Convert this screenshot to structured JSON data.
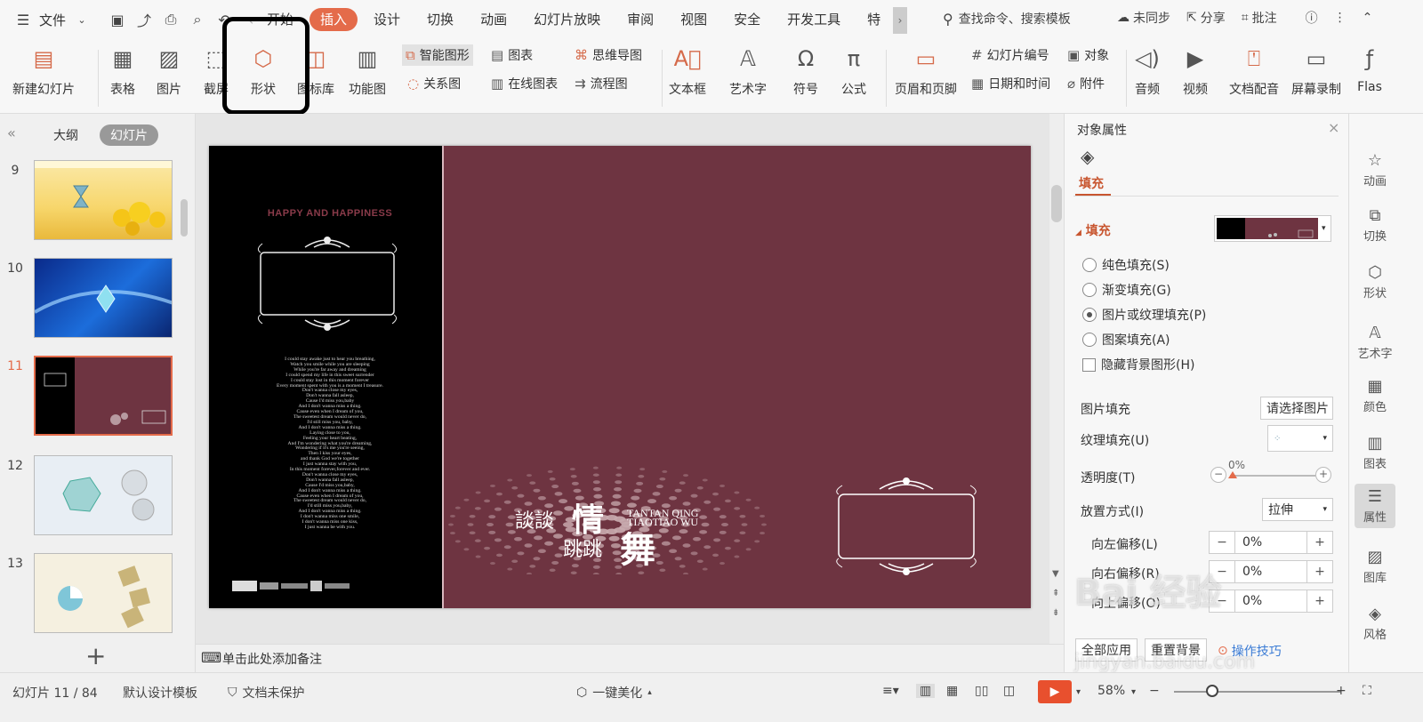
{
  "topbar": {
    "file_label": "文件",
    "tabs": [
      {
        "label": "开始"
      },
      {
        "label": "插入"
      },
      {
        "label": "设计"
      },
      {
        "label": "切换"
      },
      {
        "label": "动画"
      },
      {
        "label": "幻灯片放映"
      },
      {
        "label": "审阅"
      },
      {
        "label": "视图"
      },
      {
        "label": "安全"
      },
      {
        "label": "开发工具"
      },
      {
        "label": "特"
      }
    ],
    "search_label": "查找命令、搜索模板",
    "sync_label": "未同步",
    "share_label": "分享",
    "comment_label": "批注"
  },
  "ribbon": {
    "new_slide": "新建幻灯片",
    "table": "表格",
    "picture": "图片",
    "screenshot": "截屏",
    "shape": "形状",
    "icon_lib": "图标库",
    "function_chart": "功能图",
    "smart_art": "智能图形",
    "chart": "图表",
    "mind_map": "思维导图",
    "relation": "关系图",
    "online_chart": "在线图表",
    "flow_chart": "流程图",
    "text_box": "文本框",
    "art_text": "艺术字",
    "symbol": "符号",
    "formula": "公式",
    "header_footer": "页眉和页脚",
    "slide_number": "幻灯片编号",
    "object": "对象",
    "date_time": "日期和时间",
    "attachment": "附件",
    "audio": "音频",
    "video": "视频",
    "narration": "文档配音",
    "screen_record": "屏幕录制",
    "flash": "Flas"
  },
  "left_panel": {
    "tab_outline": "大纲",
    "tab_slides": "幻灯片",
    "thumbs": [
      {
        "num": "9"
      },
      {
        "num": "10"
      },
      {
        "num": "11"
      },
      {
        "num": "12"
      },
      {
        "num": "13"
      }
    ]
  },
  "slide": {
    "happy_text": "HAPPY AND HAPPINESS",
    "lyrics": [
      "I could stay awake just to hear you breathing,",
      "Watch you smile while you are sleeping",
      "While you're far away and dreaming",
      "I could spend my life in this sweet surrender",
      "I could stay lost in this moment forever",
      "Every moment spent with you is a moment I treasure.",
      "Don't wanna close my eyes,",
      "Don't wanna fall asleep,",
      "Cause I'd miss you,baby",
      "And I don't wanna miss a thing.",
      "Cause even when I dream of you,",
      "The sweetest dream would never do,",
      "I'd still miss you, baby,",
      "And I don't wanna miss a thing.",
      "Laying close to you,",
      "Feeling your heart beating,",
      "And I'm wondering what you're dreaming,",
      "Wondering if it's me you're seeing,",
      "Then I kiss your eyes,",
      "and thank God we're together",
      "I just wanna stay with you,",
      "In this moment forever,forever and ever.",
      "Don't wanna close my eyes,",
      "Don't wanna fall asleep,",
      "Cause I'd miss you,baby,",
      "And I don't wanna miss a thing.",
      "Cause even when I dream of you,",
      "The sweetest dream would never do,",
      "I'd still miss you,baby,",
      "And I don't wanna miss a thing.",
      "I don't wanna miss one smile,",
      "I don't wanna miss one kiss,",
      "I just wanna be with you."
    ],
    "title_cn_1": "談談",
    "title_cn_2": "情",
    "title_cn_3": "跳跳",
    "title_cn_4": "舞",
    "title_en_1": "TANTAN QING",
    "title_en_2": "TIAOTIAO WU"
  },
  "notes_placeholder": "单击此处添加备注",
  "properties": {
    "title": "对象属性",
    "fill_tab": "填充",
    "section_fill": "填充",
    "options": [
      {
        "label": "纯色填充(S)"
      },
      {
        "label": "渐变填充(G)"
      },
      {
        "label": "图片或纹理填充(P)"
      },
      {
        "label": "图案填充(A)"
      },
      {
        "label": "隐藏背景图形(H)"
      }
    ],
    "picture_fill_label": "图片填充",
    "picture_fill_value": "请选择图片",
    "texture_fill_label": "纹理填充(U)",
    "transparency_label": "透明度(T)",
    "transparency_value": "0%",
    "placement_label": "放置方式(I)",
    "placement_value": "拉伸",
    "offset_left_label": "向左偏移(L)",
    "offset_left_value": "0%",
    "offset_right_label": "向右偏移(R)",
    "offset_right_value": "0%",
    "offset_up_label": "向上偏移(O)",
    "offset_up_value": "0%",
    "apply_all": "全部应用",
    "reset_bg": "重置背景",
    "tips": "操作技巧"
  },
  "right_bar": {
    "items": [
      {
        "label": "动画"
      },
      {
        "label": "切换"
      },
      {
        "label": "形状"
      },
      {
        "label": "艺术字"
      },
      {
        "label": "颜色"
      },
      {
        "label": "图表"
      },
      {
        "label": "属性"
      },
      {
        "label": "图库"
      },
      {
        "label": "风格"
      }
    ]
  },
  "status": {
    "slide_info": "幻灯片 11 / 84",
    "template": "默认设计模板",
    "protect": "文档未保护",
    "beautify": "一键美化",
    "zoom": "58%"
  },
  "watermark": {
    "brand": "Bai 经验",
    "url": "jingyan.baidu.com"
  }
}
